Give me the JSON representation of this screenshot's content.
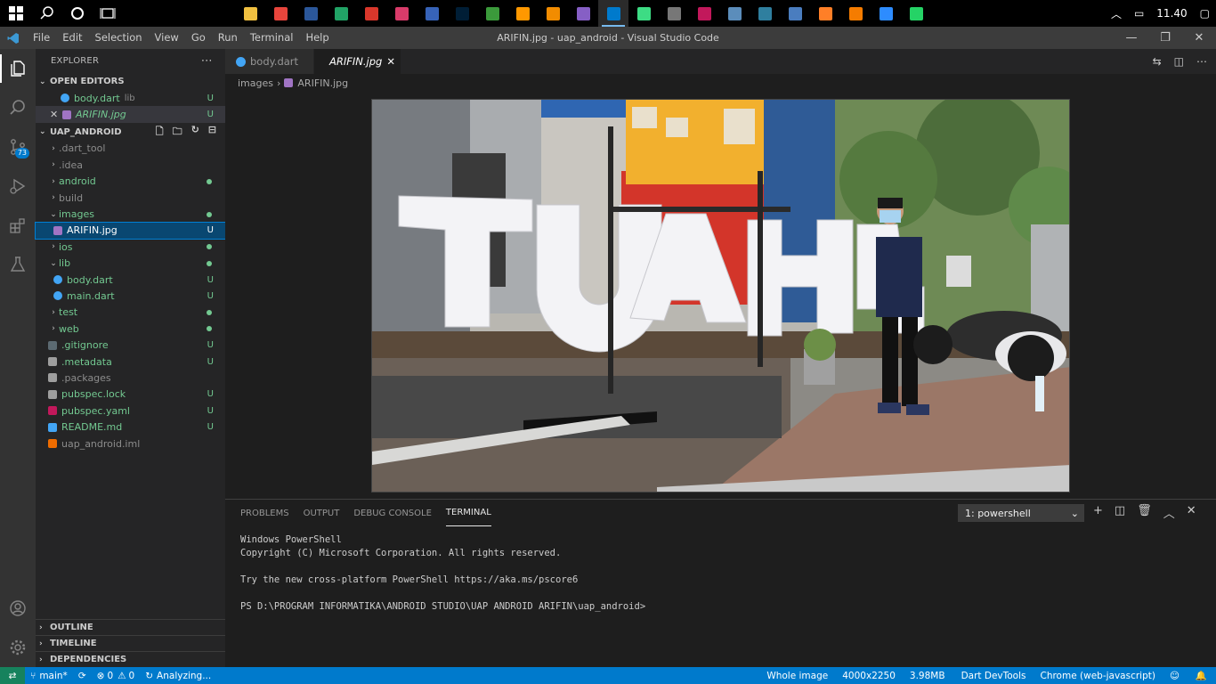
{
  "taskbar": {
    "clock": "11.40",
    "apps": [
      {
        "icon": "file-explorer-icon",
        "color": "#f0c040"
      },
      {
        "icon": "chrome-icon",
        "color": "#e8453c"
      },
      {
        "icon": "word-icon",
        "color": "#2b579a"
      },
      {
        "icon": "excel-icon",
        "color": "#21a366"
      },
      {
        "icon": "app-red-icon",
        "color": "#d9372b"
      },
      {
        "icon": "app-pink-icon",
        "color": "#d93b6a"
      },
      {
        "icon": "app-blue-icon",
        "color": "#3763b8"
      },
      {
        "icon": "photoshop-icon",
        "color": "#001e36"
      },
      {
        "icon": "app-green-icon",
        "color": "#3b9a3b"
      },
      {
        "icon": "sublime-icon",
        "color": "#ff9800"
      },
      {
        "icon": "vlc-icon",
        "color": "#f28c00"
      },
      {
        "icon": "visual-studio-icon",
        "color": "#865fc5"
      },
      {
        "icon": "vscode-icon",
        "color": "#007acc"
      },
      {
        "icon": "android-icon",
        "color": "#3ddc84"
      },
      {
        "icon": "app-dark-icon",
        "color": "#777777"
      },
      {
        "icon": "app-magenta-icon",
        "color": "#c2185b"
      },
      {
        "icon": "app-steel-icon",
        "color": "#5b8dbb"
      },
      {
        "icon": "app-teal-icon",
        "color": "#2f7f9f"
      },
      {
        "icon": "virtualbox-icon",
        "color": "#4a7dbf"
      },
      {
        "icon": "app-orange-icon",
        "color": "#ff7f27"
      },
      {
        "icon": "app-amber-icon",
        "color": "#f57c00"
      },
      {
        "icon": "zoom-icon",
        "color": "#2d8cff"
      },
      {
        "icon": "whatsapp-icon",
        "color": "#25d366"
      }
    ]
  },
  "titlebar": {
    "menu": [
      "File",
      "Edit",
      "Selection",
      "View",
      "Go",
      "Run",
      "Terminal",
      "Help"
    ],
    "title": "ARIFIN.jpg - uap_android - Visual Studio Code"
  },
  "activity": {
    "scm_badge": "73"
  },
  "sidebar": {
    "header": "EXPLORER",
    "open_editors": {
      "title": "OPEN EDITORS",
      "items": [
        {
          "name": "body.dart",
          "desc": "lib",
          "status": "U"
        },
        {
          "name": "ARIFIN.jpg",
          "status": "U"
        }
      ]
    },
    "project": {
      "title": "UAP_ANDROID",
      "items": [
        {
          "label": ".dart_tool",
          "status": ""
        },
        {
          "label": ".idea",
          "status": ""
        },
        {
          "label": "android",
          "status": "dot"
        },
        {
          "label": "build",
          "status": ""
        },
        {
          "label": "images",
          "status": "dot"
        },
        {
          "label": "ARIFIN.jpg",
          "status": "U"
        },
        {
          "label": "ios",
          "status": "dot"
        },
        {
          "label": "lib",
          "status": "dot"
        },
        {
          "label": "body.dart",
          "status": "U"
        },
        {
          "label": "main.dart",
          "status": "U"
        },
        {
          "label": "test",
          "status": "dot"
        },
        {
          "label": "web",
          "status": "dot"
        },
        {
          "label": ".gitignore",
          "status": "U"
        },
        {
          "label": ".metadata",
          "status": "U"
        },
        {
          "label": ".packages",
          "status": ""
        },
        {
          "label": "pubspec.lock",
          "status": "U"
        },
        {
          "label": "pubspec.yaml",
          "status": "U"
        },
        {
          "label": "README.md",
          "status": "U"
        },
        {
          "label": "uap_android.iml",
          "status": ""
        }
      ]
    },
    "outline": "OUTLINE",
    "timeline": "TIMELINE",
    "dependencies": "DEPENDENCIES"
  },
  "editor": {
    "tabs": [
      {
        "label": "body.dart",
        "active": false
      },
      {
        "label": "ARIFIN.jpg",
        "active": true
      }
    ],
    "breadcrumb": [
      "images",
      "ARIFIN.jpg"
    ]
  },
  "panel": {
    "tabs": [
      "PROBLEMS",
      "OUTPUT",
      "DEBUG CONSOLE",
      "TERMINAL"
    ],
    "terminal_select": "1: powershell",
    "terminal_lines": [
      "Windows PowerShell",
      "Copyright (C) Microsoft Corporation. All rights reserved.",
      "",
      "Try the new cross-platform PowerShell https://aka.ms/pscore6",
      "",
      "PS D:\\PROGRAM INFORMATIKA\\ANDROID STUDIO\\UAP ANDROID ARIFIN\\uap_android>"
    ]
  },
  "statusbar": {
    "branch": "main*",
    "errors": "0",
    "warnings": "0",
    "analyzing": "Analyzing...",
    "right": [
      "Whole image",
      "4000x2250",
      "3.98MB",
      "Dart DevTools",
      "Chrome (web-javascript)"
    ]
  },
  "colors": {
    "accent": "#007acc",
    "untracked": "#73c991",
    "status_bar": "#007acc"
  }
}
